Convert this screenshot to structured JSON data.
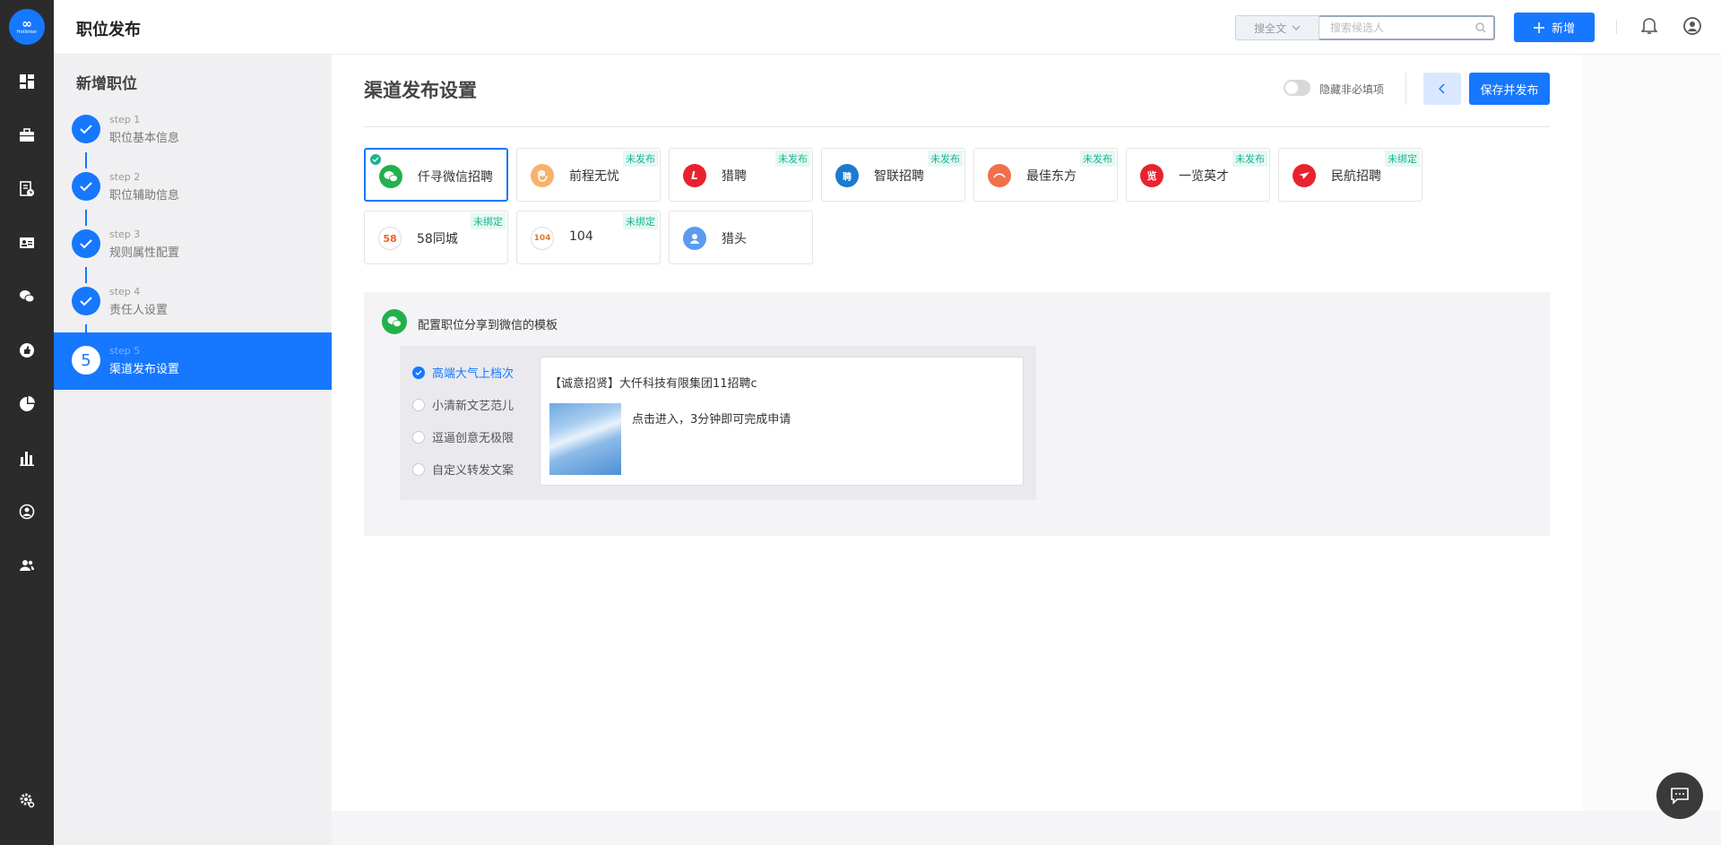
{
  "app": {
    "logo_text": "∞",
    "logo_sub": "Hotlinker",
    "page_title": "职位发布",
    "brand_color": "#1677ff"
  },
  "topbar": {
    "search_scope": "搜全文",
    "search_placeholder": "搜索候选人",
    "new_label": "新增"
  },
  "rail": {
    "icons": [
      "dashboard-icon",
      "briefcase-icon",
      "document-clock-icon",
      "id-card-icon",
      "wechat-icon",
      "thumbs-up-icon",
      "pie-chart-icon",
      "bar-chart-icon",
      "person-circle-icon",
      "team-icon",
      "settings-icon"
    ]
  },
  "steps": {
    "title": "新增职位",
    "items": [
      {
        "num": "step 1",
        "label": "职位基本信息",
        "done": true
      },
      {
        "num": "step 2",
        "label": "职位辅助信息",
        "done": true
      },
      {
        "num": "step 3",
        "label": "规则属性配置",
        "done": true
      },
      {
        "num": "step 4",
        "label": "责任人设置",
        "done": true
      },
      {
        "num": "step 5",
        "label": "渠道发布设置",
        "done": false,
        "index": "5"
      }
    ]
  },
  "main": {
    "title": "渠道发布设置",
    "toggle_label": "隐藏非必填项",
    "save_label": "保存并发布"
  },
  "channels": [
    {
      "name": "仟寻微信招聘",
      "tag": "",
      "selected": true,
      "icon": "wechat-icon",
      "color": "#22b14c"
    },
    {
      "name": "前程无忧",
      "tag": "未发布",
      "icon": "hand-icon",
      "color": "#f6b26b"
    },
    {
      "name": "猎聘",
      "tag": "未发布",
      "icon": "liepin-icon",
      "color": "#e8222f"
    },
    {
      "name": "智联招聘",
      "tag": "未发布",
      "icon": "zhilian-icon",
      "color": "#1a7bd0"
    },
    {
      "name": "最佳东方",
      "tag": "未发布",
      "icon": "sunrise-icon",
      "color": "#f0704a"
    },
    {
      "name": "一览英才",
      "tag": "未发布",
      "icon": "yilan-icon",
      "color": "#e8222f"
    },
    {
      "name": "民航招聘",
      "tag": "未绑定",
      "icon": "plane-icon",
      "color": "#e8222f"
    },
    {
      "name": "58同城",
      "tag": "未绑定",
      "icon": "58-icon",
      "color": "#ffffff"
    },
    {
      "name": "104",
      "tag": "未绑定",
      "icon": "104-icon",
      "color": "#ffffff"
    },
    {
      "name": "猎头",
      "tag": "",
      "icon": "headhunter-icon",
      "color": "#5b9bf0"
    }
  ],
  "config": {
    "title": "配置职位分享到微信的模板",
    "options": [
      "高端大气上档次",
      "小清新文艺范儿",
      "逗逼创意无极限",
      "自定义转发文案"
    ],
    "selected_option": 0,
    "preview_title": "【诚意招贤】大仟科技有限集团11招聘c",
    "preview_desc": "点击进入，3分钟即可完成申请"
  }
}
